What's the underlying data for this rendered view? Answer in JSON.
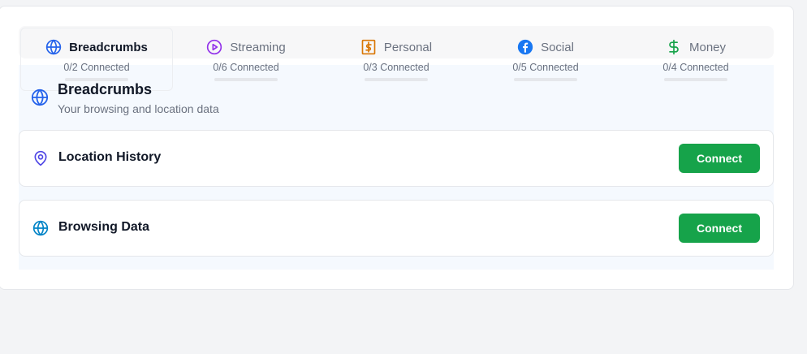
{
  "tabs": [
    {
      "label": "Breadcrumbs",
      "status": "0/2 Connected",
      "progress": 0,
      "icon": "globe-icon",
      "color": "#2563eb",
      "active": true
    },
    {
      "label": "Streaming",
      "status": "0/6 Connected",
      "progress": 0,
      "icon": "play-icon",
      "color": "#9333ea",
      "active": false
    },
    {
      "label": "Personal",
      "status": "0/3 Connected",
      "progress": 0,
      "icon": "dollar-square-icon",
      "color": "#d97706",
      "active": false
    },
    {
      "label": "Social",
      "status": "0/5 Connected",
      "progress": 0,
      "icon": "facebook-icon",
      "color": "#1877f2",
      "active": false
    },
    {
      "label": "Money",
      "status": "0/4 Connected",
      "progress": 0,
      "icon": "dollar-icon",
      "color": "#16a34a",
      "active": false
    }
  ],
  "section": {
    "title": "Breadcrumbs",
    "subtitle": "Your browsing and location data",
    "icon": "globe-icon",
    "color": "#2563eb"
  },
  "items": [
    {
      "label": "Location History",
      "icon": "map-pin-icon",
      "color": "#4f46e5",
      "button": "Connect"
    },
    {
      "label": "Browsing Data",
      "icon": "globe-icon",
      "color": "#0284c7",
      "button": "Connect"
    }
  ],
  "colors": {
    "accent": "#16a34a",
    "panel_bg": "#f5f9fe"
  }
}
